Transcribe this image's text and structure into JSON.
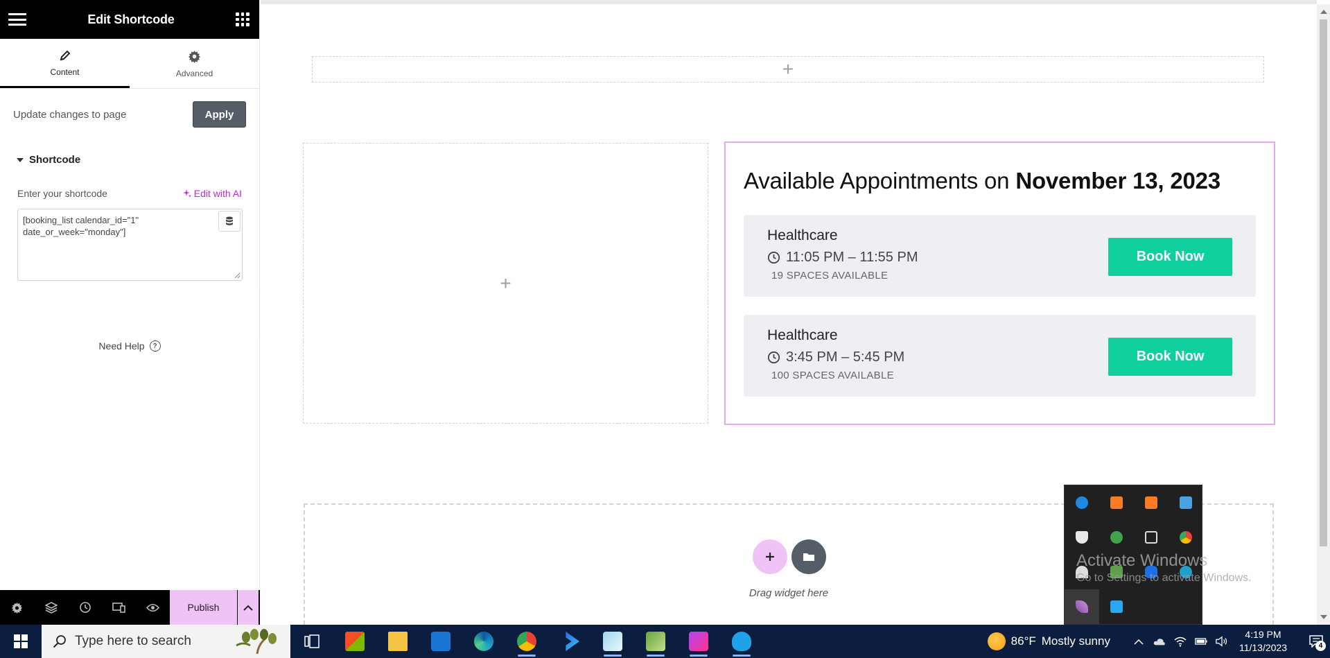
{
  "panel": {
    "title": "Edit Shortcode",
    "tabs": [
      {
        "label": "Content",
        "icon": "pencil-icon",
        "active": true
      },
      {
        "label": "Advanced",
        "icon": "gear-icon",
        "active": false
      }
    ],
    "update_label": "Update changes to page",
    "apply_label": "Apply",
    "section_title": "Shortcode",
    "field_label": "Enter your shortcode",
    "edit_ai_label": "Edit with AI",
    "shortcode_value": "[booking_list calendar_id=\"1\" date_or_week=\"monday\"]",
    "need_help_label": "Need Help",
    "footer": {
      "icons": [
        "settings-icon",
        "layers-icon",
        "history-icon",
        "responsive-icon",
        "preview-eye-icon"
      ],
      "publish_label": "Publish"
    }
  },
  "widget": {
    "title_prefix": "Available Appointments on",
    "title_date": "November 13, 2023",
    "appointments": [
      {
        "name": "Healthcare",
        "time": "11:05 PM – 11:55 PM",
        "spaces": "19 SPACES AVAILABLE",
        "button": "Book Now"
      },
      {
        "name": "Healthcare",
        "time": "3:45 PM – 5:45 PM",
        "spaces": "100 SPACES AVAILABLE",
        "button": "Book Now"
      }
    ]
  },
  "drop_zone": {
    "drag_text": "Drag widget here"
  },
  "watermark": {
    "line1": "Activate Windows",
    "line2": "Go to Settings to activate Windows."
  },
  "taskbar": {
    "search_placeholder": "Type here to search",
    "weather_temp": "86°F",
    "weather_text": "Mostly sunny",
    "time": "4:19 PM",
    "date": "11/13/2023",
    "notification_count": "4"
  },
  "colors": {
    "accent_pink": "#f0c3f7",
    "book_green": "#0fcf9d",
    "ai_magenta": "#c026d3",
    "taskbar": "#0b1e3f"
  }
}
